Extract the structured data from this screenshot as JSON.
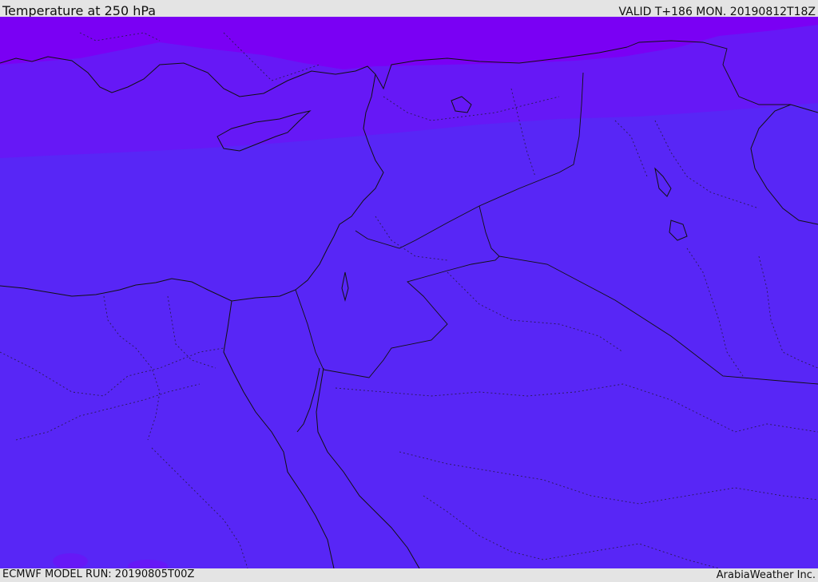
{
  "header": {
    "title": "Temperature at 250 hPa",
    "valid": "VALID T+186 MON. 20190812T18Z"
  },
  "footer": {
    "model_run": "ECMWF MODEL RUN: 20190805T00Z",
    "credit": "ArabiaWeather Inc."
  },
  "map": {
    "parameter": "temperature",
    "level": "250 hPa",
    "colors": {
      "cold_band": "#7a00f4",
      "mid_band": "#6618f6",
      "base_field": "#5826f6",
      "coastline": "#111111",
      "borders": "#1a1a3a"
    }
  }
}
